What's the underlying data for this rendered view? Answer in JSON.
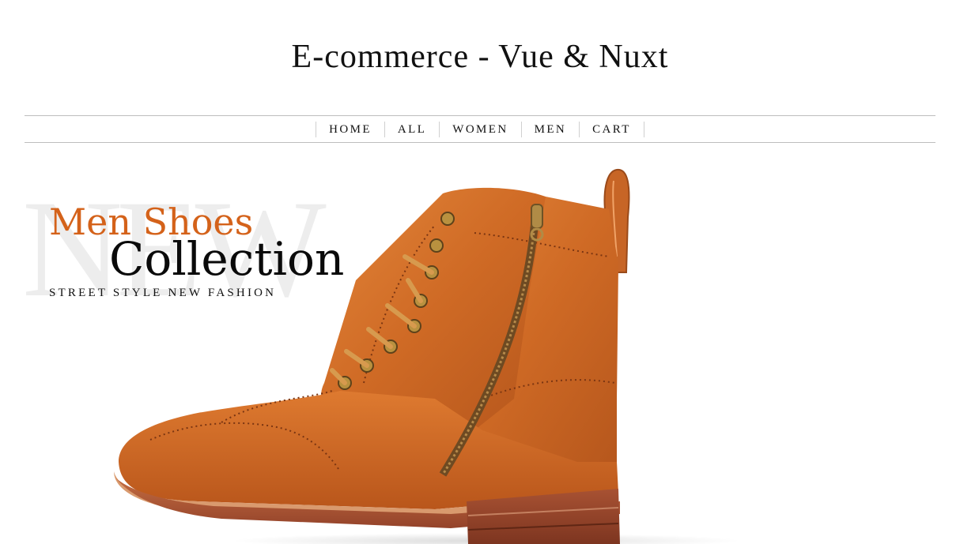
{
  "header": {
    "title": "E-commerce - Vue & Nuxt"
  },
  "nav": {
    "items": [
      {
        "label": "HOME"
      },
      {
        "label": "ALL"
      },
      {
        "label": "WOMEN"
      },
      {
        "label": "MEN"
      },
      {
        "label": "CART"
      }
    ]
  },
  "hero": {
    "background_word": "NEW",
    "subtitle": "Men Shoes",
    "title": "Collection",
    "tagline": "STREET STYLE NEW FASHION",
    "image": "brown-leather-zip-boot",
    "colors": {
      "accent": "#d4621a",
      "leather": "#cf6a25",
      "sole": "#9a4526"
    }
  }
}
